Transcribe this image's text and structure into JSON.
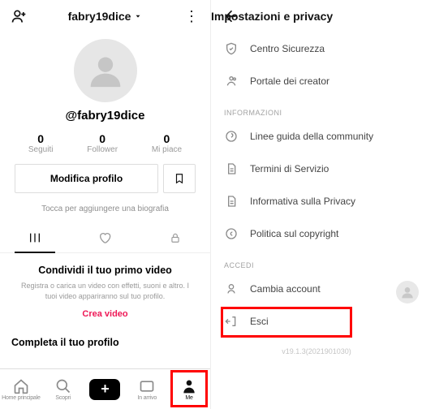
{
  "left": {
    "title": "fabry19dice",
    "handle": "@fabry19dice",
    "stats": [
      {
        "num": "0",
        "label": "Seguiti"
      },
      {
        "num": "0",
        "label": "Follower"
      },
      {
        "num": "0",
        "label": "Mi piace"
      }
    ],
    "edit_button": "Modifica profilo",
    "bio_hint": "Tocca per aggiungere una biografia",
    "promo": {
      "title": "Condividi il tuo primo video",
      "sub": "Registra o carica un video con effetti, suoni e altro. I tuoi video appariranno sul tuo profilo.",
      "cta": "Crea video"
    },
    "complete": "Completa il tuo profilo",
    "nav": {
      "home": "Home principale",
      "discover": "Scopri",
      "inbox": "In arrivo",
      "me": "Me"
    }
  },
  "right": {
    "title": "Impostazioni e privacy",
    "items_top": [
      {
        "icon": "shield",
        "label": "Centro Sicurezza"
      },
      {
        "icon": "creator",
        "label": "Portale dei creator"
      }
    ],
    "section_info": "INFORMAZIONI",
    "items_info": [
      {
        "icon": "help",
        "label": "Linee guida della community"
      },
      {
        "icon": "doc",
        "label": "Termini di Servizio"
      },
      {
        "icon": "doc",
        "label": "Informativa sulla Privacy"
      },
      {
        "icon": "copyright",
        "label": "Politica sul copyright"
      }
    ],
    "section_acc": "ACCEDI",
    "items_acc": [
      {
        "icon": "switch",
        "label": "Cambia account"
      },
      {
        "icon": "logout",
        "label": "Esci"
      }
    ],
    "version": "v19.1.3(2021901030)"
  }
}
